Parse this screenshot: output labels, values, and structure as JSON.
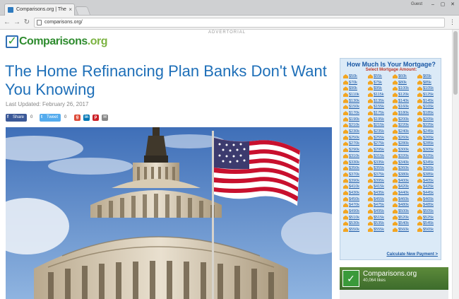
{
  "browser": {
    "tab_title": "Comparisons.org | The",
    "profile_label": "Guest",
    "url": "comparisons.org/"
  },
  "page": {
    "advert_label": "ADVERTORIAL",
    "logo": {
      "word": "Comparisons",
      "tld": ".org"
    },
    "headline": "The Home Refinancing Plan Banks Don't Want You Knowing",
    "last_updated": "Last Updated: February 26, 2017",
    "share": {
      "facebook_label": "Share",
      "facebook_count": "0",
      "twitter_label": "Tweet",
      "twitter_count": "0"
    }
  },
  "mortgage_widget": {
    "title": "How Much Is Your Mortgage?",
    "subtitle": "Select Mortgage Amount:",
    "amounts": [
      "$50k",
      "$55k",
      "$60k",
      "$65k",
      "$70k",
      "$75k",
      "$80k",
      "$85k",
      "$90k",
      "$95k",
      "$100k",
      "$105k",
      "$110k",
      "$115k",
      "$120k",
      "$125k",
      "$130k",
      "$135k",
      "$140k",
      "$145k",
      "$150k",
      "$155k",
      "$160k",
      "$165k",
      "$170k",
      "$175k",
      "$180k",
      "$185k",
      "$190k",
      "$195k",
      "$200k",
      "$205k",
      "$210k",
      "$215k",
      "$220k",
      "$225k",
      "$230k",
      "$235k",
      "$240k",
      "$245k",
      "$250k",
      "$255k",
      "$260k",
      "$265k",
      "$270k",
      "$275k",
      "$280k",
      "$285k",
      "$290k",
      "$295k",
      "$300k",
      "$305k",
      "$310k",
      "$315k",
      "$320k",
      "$325k",
      "$330k",
      "$335k",
      "$340k",
      "$345k",
      "$350k",
      "$355k",
      "$360k",
      "$365k",
      "$370k",
      "$375k",
      "$380k",
      "$385k",
      "$390k",
      "$395k",
      "$400k",
      "$405k",
      "$410k",
      "$415k",
      "$420k",
      "$425k",
      "$430k",
      "$435k",
      "$440k",
      "$445k",
      "$450k",
      "$455k",
      "$460k",
      "$465k",
      "$470k",
      "$475k",
      "$480k",
      "$485k",
      "$490k",
      "$495k",
      "$500k",
      "$505k",
      "$510k",
      "$515k",
      "$520k",
      "$525k",
      "$530k",
      "$535k",
      "$540k",
      "$545k",
      "$550k",
      "$555k",
      "$560k",
      "$565k"
    ],
    "cta": "Calculate New Payment  >"
  },
  "facebook_box": {
    "name": "Comparisons.org",
    "likes": "40,064 likes"
  }
}
